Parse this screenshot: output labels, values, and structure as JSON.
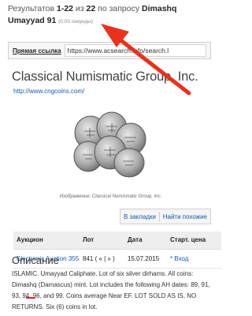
{
  "results": {
    "prefix": "Результатов",
    "range": "1-22",
    "of": "из",
    "total": "22",
    "by_query": "по запросу",
    "query_line1": "Dimashq",
    "query_line2": "Umayyad 91",
    "time": "(0.03 секунды)"
  },
  "direct_link": {
    "label": "Прямая ссылка",
    "url": "https://www.acsearch.info/search.l"
  },
  "org": {
    "name": "Classical Numismatic Group, Inc.",
    "url": "http://www.cngcoins.com/"
  },
  "image": {
    "caption": "Изображение: Classical Numismatic Group, Inc."
  },
  "actions": {
    "bookmark": "В закладки",
    "similar": "Найти похожие"
  },
  "table": {
    "headers": [
      "Аукцион",
      "Лот",
      "Дата",
      "Старт. цена"
    ],
    "row": {
      "auction": "Electronic Auction 355",
      "lot": "841 ( « | » )",
      "date": "15.07.2015",
      "price": "* Вход"
    }
  },
  "description": {
    "title": "Описание",
    "text": "ISLAMIC. Umayyad Caliphate. Lot of six silver dirhams. All coins: Dimashq (Damascus) mint. Lot includes the following AH dates: 89, 91, 93, 94, 96, and 99. Coins average Near EF. LOT SOLD AS IS, NO RETURNS. Six (6) coins in lot."
  },
  "colors": {
    "link": "#1a5aa8",
    "arrow": "#e8321e",
    "underline": "#e02020"
  }
}
